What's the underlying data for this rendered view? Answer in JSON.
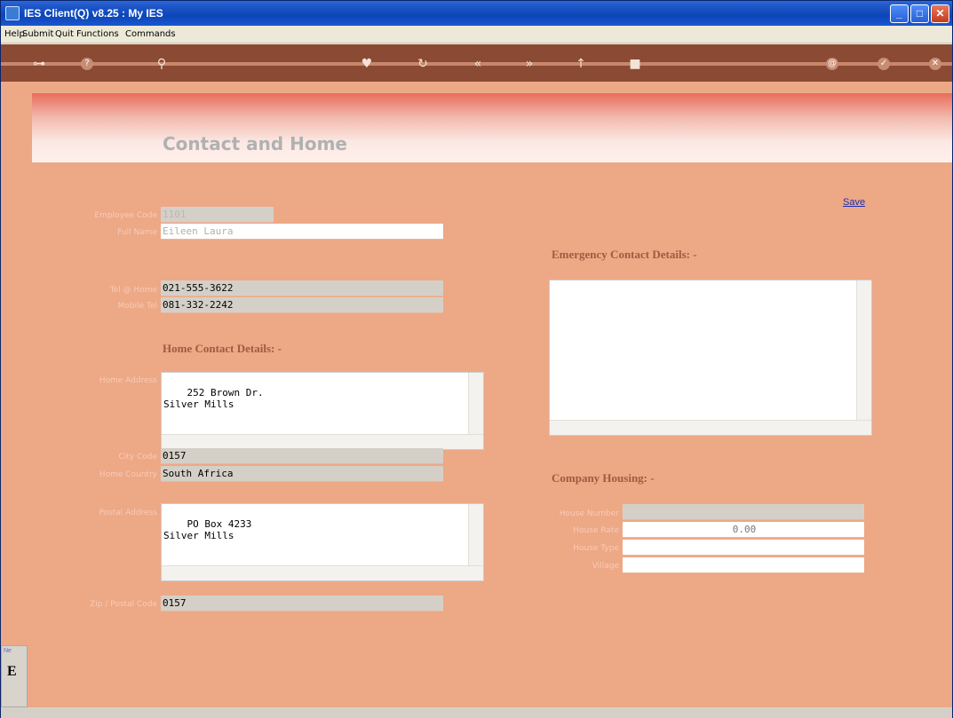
{
  "window": {
    "title": "IES Client(Q) v8.25 : My IES",
    "min_label": "_",
    "max_label": "□",
    "close_label": "✕"
  },
  "menu": {
    "items": [
      "Help",
      "Submit",
      "Quit",
      "Functions",
      "Commands"
    ]
  },
  "toolbar": {
    "icons": [
      "key-icon",
      "help-icon",
      "search-icon",
      "heart-icon",
      "refresh-icon",
      "rewind-icon",
      "fast-forward-icon",
      "pin-icon",
      "square-icon",
      "email-icon",
      "check-icon",
      "close-icon"
    ],
    "help_glyph": "?",
    "search_glyph": "⚲",
    "heart_glyph": "♥",
    "refresh_glyph": "↻",
    "rewind_glyph": "«",
    "forward_glyph": "»",
    "pin_glyph": "↑",
    "square_glyph": "■",
    "email_glyph": "@",
    "check_glyph": "✓",
    "close_glyph": "✕",
    "key_glyph": "⊶"
  },
  "header": {
    "title": "Contact and Home"
  },
  "actions": {
    "save_label": "Save"
  },
  "employee": {
    "code_label": "Employee Code",
    "code_value": "1101",
    "fullname_label": "Full Name",
    "fullname_value": "Eileen Laura"
  },
  "phones": {
    "home_label": "Tel @ Home",
    "home_value": "021-555-3622",
    "mobile_label": "Mobile Tel",
    "mobile_value": "081-332-2242"
  },
  "home_contact": {
    "section_title": "Home Contact Details: -",
    "address_label": "Home Address",
    "address_value": "252 Brown Dr.\nSilver Mills",
    "city_code_label": "City Code",
    "city_code_value": "0157",
    "country_label": "Home Country",
    "country_value": "South Africa",
    "postal_label": "Postal Address",
    "postal_value": "PO Box 4233\nSilver Mills",
    "zip_label": "Zip / Postal Code",
    "zip_value": "0157"
  },
  "emergency": {
    "section_title": "Emergency Contact Details: -",
    "value": ""
  },
  "company_housing": {
    "section_title": "Company Housing: -",
    "house_number_label": "House Number",
    "house_number_value": "",
    "house_rate_label": "House Rate",
    "house_rate_value": "0.00",
    "house_type_label": "House Type",
    "house_type_value": "",
    "village_label": "Village",
    "village_value": ""
  },
  "side_tab": {
    "letter": "E",
    "tiny": "Ne"
  }
}
